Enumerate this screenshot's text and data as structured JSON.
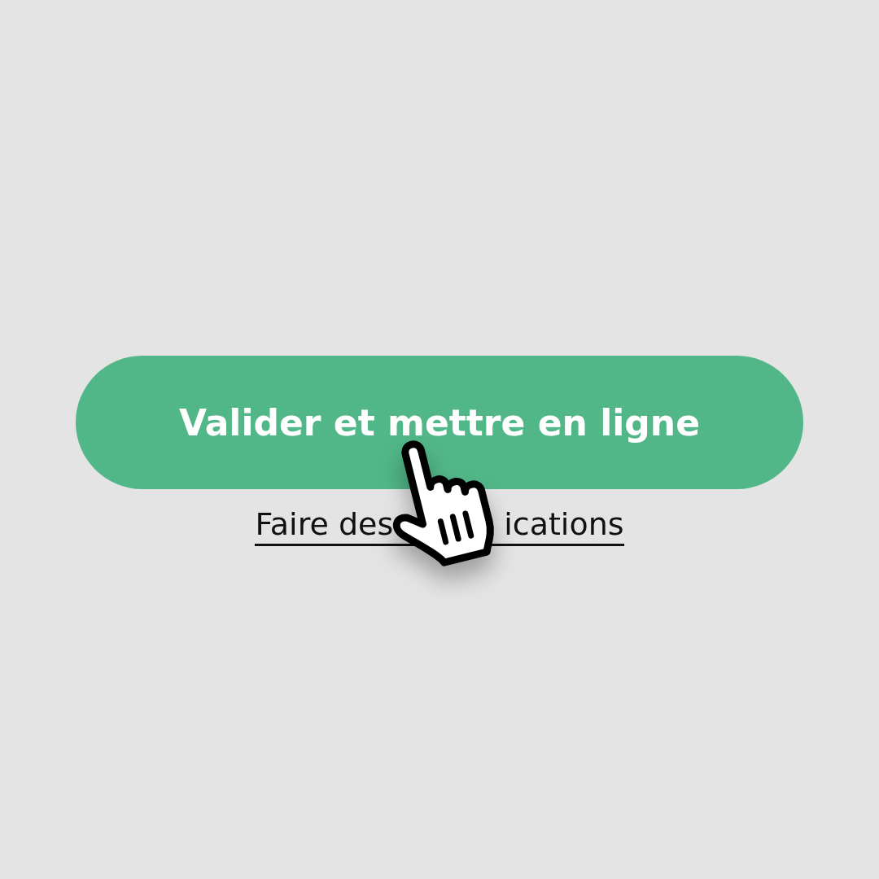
{
  "primary_button": {
    "label": "Valider et mettre en ligne"
  },
  "secondary_link": {
    "visible_parts": [
      "Faire des",
      "ications"
    ]
  }
}
